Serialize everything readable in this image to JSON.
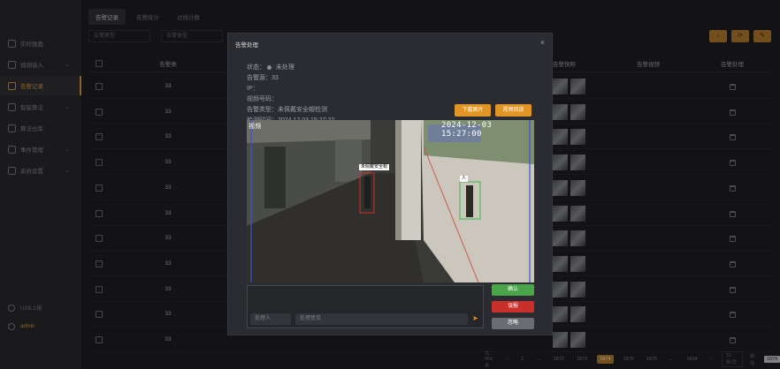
{
  "sidebar": {
    "items": [
      {
        "label": "实时画面",
        "has_chevron": false,
        "active": false,
        "icon": "monitor-icon"
      },
      {
        "label": "视频接入",
        "has_chevron": true,
        "active": false,
        "icon": "camera-icon"
      },
      {
        "label": "告警记录",
        "has_chevron": false,
        "active": true,
        "icon": "alarm-icon"
      },
      {
        "label": "智能算法",
        "has_chevron": true,
        "active": false,
        "icon": "chip-icon"
      },
      {
        "label": "算法仓库",
        "has_chevron": false,
        "active": false,
        "icon": "box-icon"
      },
      {
        "label": "事件管理",
        "has_chevron": true,
        "active": false,
        "icon": "event-icon"
      },
      {
        "label": "系统设置",
        "has_chevron": true,
        "active": false,
        "icon": "settings-icon"
      }
    ],
    "footer": {
      "usb_label": "USB上报",
      "user_label": "admin"
    }
  },
  "tabs": [
    {
      "label": "告警记录",
      "active": true
    },
    {
      "label": "告警统计",
      "active": false
    },
    {
      "label": "过线计数",
      "active": false
    }
  ],
  "filters": [
    {
      "placeholder": "告警类型"
    },
    {
      "placeholder": "告警类型"
    }
  ],
  "toolbar": [
    "↓",
    "⟳",
    "✎"
  ],
  "table": {
    "headers": {
      "checkbox": "",
      "id": "告警类",
      "image": "告警快照",
      "recording": "告警视频",
      "ops": "告警处理"
    },
    "rows": [
      "33",
      "33",
      "33",
      "33",
      "33",
      "33",
      "33",
      "33",
      "33",
      "33",
      "33"
    ]
  },
  "pagination": {
    "total": "共858条",
    "prev": "‹",
    "pages": [
      "1",
      "…",
      "1872",
      "1873",
      "1874",
      "1875",
      "1876",
      "…",
      "1834"
    ],
    "active_page": "1874",
    "next": "›",
    "page_size": "10 条/页",
    "goto_label": "前往",
    "goto_value": "1874"
  },
  "modal": {
    "title": "告警处理",
    "close": "×",
    "status_label": "状态：",
    "status_value": "未处理",
    "fields": [
      "告警源：33",
      "IP：",
      "视频号码：",
      "告警类型：未佩戴安全帽检测",
      "检测时间：2024 12 03 15:27:22"
    ],
    "download_image": "下载图片",
    "download_video": "视频回放",
    "image": {
      "timestamp": "2024-12-03 15:27:00",
      "corner_text": "视频",
      "detection_label_1": "未佩戴安全帽",
      "detection_label_2": "人"
    },
    "operator_placeholder": "处理人",
    "note_placeholder": "处理意见",
    "send_icon": "➤",
    "confirm_label": "确认",
    "report_label": "误报",
    "ignore_label": "忽略"
  },
  "colors": {
    "accent": "#e09524",
    "confirm": "#4aa44a",
    "report": "#c9302c",
    "ignore": "#6b6d73"
  }
}
